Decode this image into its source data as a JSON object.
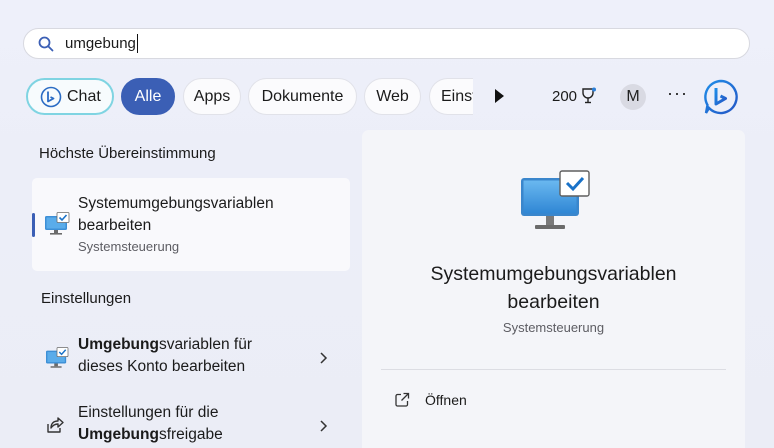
{
  "search": {
    "query": "umgebung"
  },
  "filters": {
    "chat": "Chat",
    "alle": "Alle",
    "apps": "Apps",
    "dokumente": "Dokumente",
    "web": "Web",
    "einst": "Einst",
    "points": "200",
    "avatar": "M",
    "more": "···"
  },
  "best_match": {
    "heading": "Höchste Übereinstimmung",
    "title_line1": "Systemumgebungsvariablen",
    "title_line2": "bearbeiten",
    "subtitle": "Systemsteuerung",
    "icon": "monitor-check-icon"
  },
  "settings": {
    "heading": "Einstellungen",
    "items": [
      {
        "bold": "Umgebung",
        "rest": "svariablen für",
        "line2": "dieses Konto bearbeiten",
        "icon": "monitor-check-icon"
      },
      {
        "line1": "Einstellungen für die",
        "bold": "Umgebung",
        "rest": "sfreigabe",
        "icon": "share-icon"
      }
    ]
  },
  "detail": {
    "title_line1": "Systemumgebungsvariablen",
    "title_line2": "bearbeiten",
    "subtitle": "Systemsteuerung",
    "actions": [
      {
        "label": "Öffnen",
        "icon": "open-external-icon"
      }
    ]
  },
  "colors": {
    "accent": "#3b5fb5",
    "chat_border": "#7fd4e2"
  }
}
